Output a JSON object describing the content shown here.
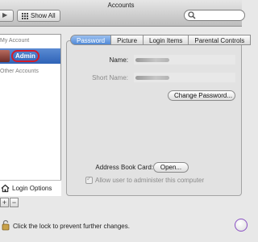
{
  "window": {
    "title": "Accounts"
  },
  "toolbar": {
    "show_all_label": "Show All"
  },
  "sidebar": {
    "my_account_header": "My Account",
    "selected_user": "Admin",
    "other_accounts_header": "Other Accounts",
    "login_options_label": "Login Options",
    "plus_label": "+",
    "minus_label": "−"
  },
  "tabs": [
    {
      "label": "Password",
      "active": true
    },
    {
      "label": "Picture"
    },
    {
      "label": "Login Items"
    },
    {
      "label": "Parental Controls"
    }
  ],
  "password_pane": {
    "name_label": "Name:",
    "short_name_label": "Short Name:",
    "change_password_button": "Change Password...",
    "address_book_label": "Address Book Card:",
    "open_button": "Open...",
    "allow_admin_label": "Allow user to administer this computer",
    "allow_admin_checked": true
  },
  "footer": {
    "lock_text": "Click the lock to prevent further changes."
  },
  "colors": {
    "selection": "#2e63b7",
    "active_tab": "#4f8ad8",
    "highlight_circle": "#d31b2a",
    "help_ring": "#8a4fc4"
  },
  "icons": [
    "grid-icon",
    "search-icon",
    "house-icon",
    "lock-icon",
    "help-icon",
    "avatar-image"
  ]
}
